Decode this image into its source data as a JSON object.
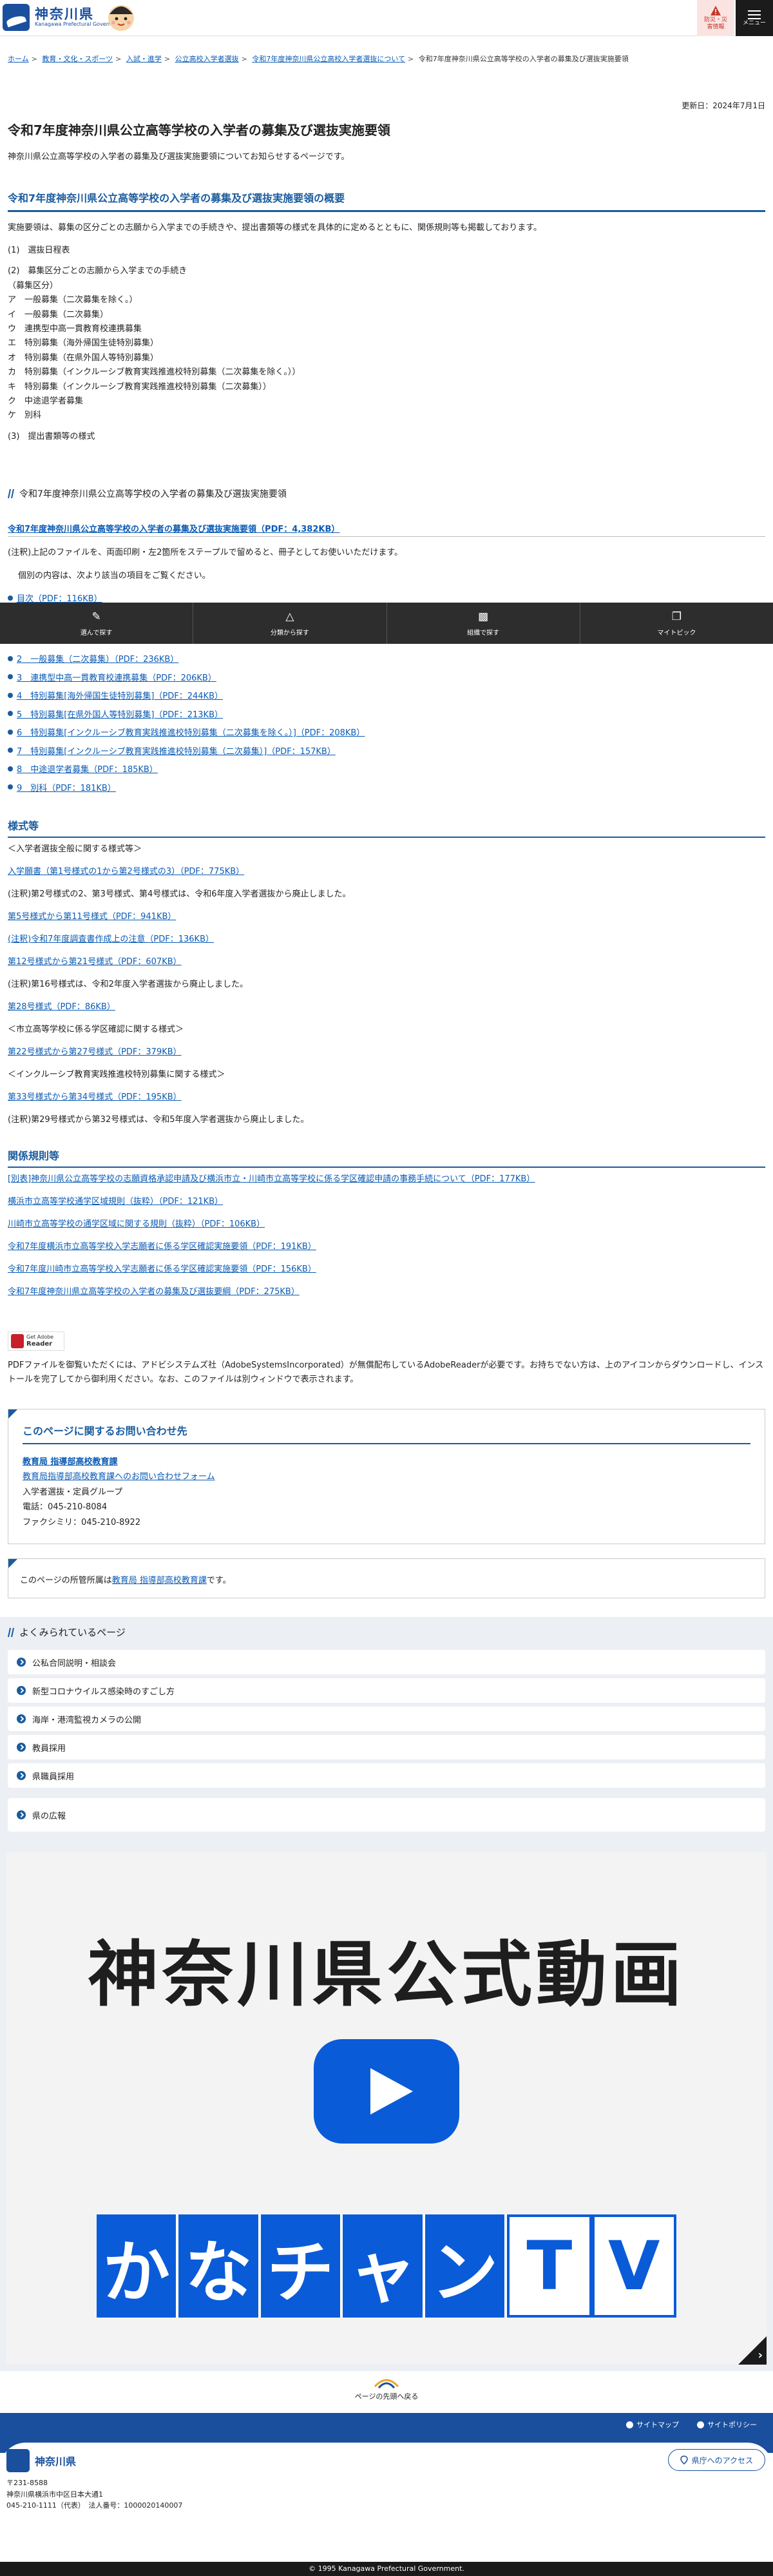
{
  "header": {
    "logo_title": "神奈川県",
    "logo_sub": "Kanagawa Prefectural Government",
    "btn_disaster": [
      "防災・災",
      "害情報"
    ],
    "btn_menu": "メニュー"
  },
  "breadcrumb": [
    "ホーム",
    "教育・文化・スポーツ",
    "入試・進学",
    "公立高校入学者選抜",
    "令和7年度神奈川県公立高校入学者選抜について",
    "令和7年度神奈川県公立高等学校の入学者の募集及び選抜実施要領"
  ],
  "updated": "更新日：2024年7月1日",
  "title": "令和7年度神奈川県公立高等学校の入学者の募集及び選抜実施要領",
  "lead": "神奈川県公立高等学校の入学者の募集及び選抜実施要領についてお知らせするページです。",
  "overview": {
    "heading": "令和7年度神奈川県公立高等学校の入学者の募集及び選抜実施要領の概要",
    "intro": "実施要領は、募集の区分ごとの志願から入学までの手続きや、提出書類等の様式を具体的に定めるとともに、関係規則等も掲載しております。",
    "lines": [
      "(1)　選抜日程表",
      "(2)　募集区分ごとの志願から入学までの手続き",
      "（募集区分）",
      "ア　一般募集（二次募集を除く。）",
      "イ　一般募集（二次募集）",
      "ウ　連携型中高一貫教育校連携募集",
      "エ　特別募集（海外帰国生徒特別募集）",
      "オ　特別募集（在県外国人等特別募集）",
      "カ　特別募集（インクルーシブ教育実践推進校特別募集（二次募集を除く。））",
      "キ　特別募集（インクルーシブ教育実践推進校特別募集（二次募集））",
      "ク　中途退学者募集",
      "ケ　別科",
      "(3)　提出書類等の様式"
    ]
  },
  "sub_heading": "令和7年度神奈川県公立高等学校の入学者の募集及び選抜実施要領",
  "main_pdf": "令和7年度神奈川県公立高等学校の入学者の募集及び選抜実施要領（PDF：4,382KB）",
  "note1": "(注釈)上記のファイルを、両面印刷・左2箇所をステープルで留めると、冊子としてお使いいただけます。",
  "note2": "個別の内容は、次より該当の項目をご覧ください。",
  "toc": "目次（PDF：116KB）",
  "sticky_nav": [
    "選んで探す",
    "分類から探す",
    "組織で探す",
    "マイトピック"
  ],
  "pdf_items": [
    "2　一般募集（二次募集）（PDF：236KB）",
    "3　連携型中高一貫教育校連携募集（PDF：206KB）",
    "4　特別募集[海外帰国生徒特別募集]（PDF：244KB）",
    "5　特別募集[在県外国人等特別募集]（PDF：213KB）",
    "6　特別募集[インクルーシブ教育実践推進校特別募集（二次募集を除く。）]（PDF：208KB）",
    "7　特別募集[インクルーシブ教育実践推進校特別募集（二次募集）]（PDF：157KB）",
    "8　中途退学者募集（PDF：185KB）",
    "9　別科（PDF：181KB）"
  ],
  "forms": {
    "heading": "様式等",
    "items": [
      {
        "t": "＜入学者選抜全般に関する様式等＞",
        "link": false
      },
      {
        "t": "入学願書（第1号様式の1から第2号様式の3）（PDF：775KB）",
        "link": true
      },
      {
        "t": "(注釈)第2号様式の2、第3号様式、第4号様式は、令和6年度入学者選抜から廃止しました。",
        "link": false
      },
      {
        "t": "第5号様式から第11号様式（PDF：941KB）",
        "link": true
      },
      {
        "t": "(注釈)令和7年度調査書作成上の注意（PDF：136KB）",
        "link": true
      },
      {
        "t": "第12号様式から第21号様式（PDF：607KB）",
        "link": true
      },
      {
        "t": "(注釈)第16号様式は、令和2年度入学者選抜から廃止しました。",
        "link": false
      },
      {
        "t": "第28号様式（PDF：86KB）",
        "link": true
      },
      {
        "t": "＜市立高等学校に係る学区確認に関する様式＞",
        "link": false
      },
      {
        "t": "第22号様式から第27号様式（PDF：379KB）",
        "link": true
      },
      {
        "t": "＜インクルーシブ教育実践推進校特別募集に関する様式＞",
        "link": false
      },
      {
        "t": "第33号様式から第34号様式（PDF：195KB）",
        "link": true
      },
      {
        "t": "(注釈)第29号様式から第32号様式は、令和5年度入学者選抜から廃止しました。",
        "link": false
      }
    ]
  },
  "rules": {
    "heading": "関係規則等",
    "items": [
      "[別表]神奈川県公立高等学校の志願資格承認申請及び横浜市立・川崎市立高等学校に係る学区確認申請の事務手続について（PDF：177KB）",
      "横浜市立高等学校通学区域規則（抜粋）（PDF：121KB）",
      "川崎市立高等学校の通学区域に関する規則（抜粋）（PDF：106KB）",
      "令和7年度横浜市立高等学校入学志願者に係る学区確認実施要領（PDF：191KB）",
      "令和7年度川崎市立高等学校入学志願者に係る学区確認実施要領（PDF：156KB）",
      "令和7年度神奈川県立高等学校の入学者の募集及び選抜要綱（PDF：275KB）"
    ]
  },
  "adobe": {
    "badge_top": "Get Adobe",
    "badge_bottom": "Reader",
    "text": "PDFファイルを御覧いただくには、アドビシステムズ社（AdobeSystemsIncorporated）が無償配布しているAdobeReaderが必要です。お持ちでない方は、上のアイコンからダウンロードし、インストールを完了してから御利用ください。なお、このファイルは別ウィンドウで表示されます。"
  },
  "contact": {
    "heading": "このページに関するお問い合わせ先",
    "org": "教育局 指導部高校教育課",
    "form": "教育局指導部高校教育課へのお問い合わせフォーム",
    "group": "入学者選抜・定員グループ",
    "tel": "電話：045-210-8084",
    "fax": "ファクシミリ：045-210-8922"
  },
  "owner": {
    "prefix": "このページの所管所属は",
    "link": "教育局 指導部高校教育課",
    "suffix": "です。"
  },
  "frequent": {
    "heading": "よくみられているページ",
    "items": [
      "公私合同説明・相談会",
      "新型コロナウイルス感染時のすごし方",
      "海岸・港湾監視カメラの公開",
      "教員採用",
      "県職員採用"
    ],
    "extra": "県の広報"
  },
  "banner": {
    "title": "神奈川県公式動画",
    "kana": [
      "か",
      "な",
      "チ",
      "ャ",
      "ン",
      "T",
      "V"
    ]
  },
  "to_top": "ページの先頭へ戻る",
  "footer": {
    "sitemap": "サイトマップ",
    "policy": "サイトポリシー",
    "logo": "神奈川県",
    "access": "県庁へのアクセス",
    "addr": [
      "〒231-8588",
      "神奈川県横浜市中区日本大通1",
      "045-210-1111（代表）　法人番号：1000020140007"
    ],
    "copyright": "© 1995 Kanagawa Prefectural Government."
  }
}
